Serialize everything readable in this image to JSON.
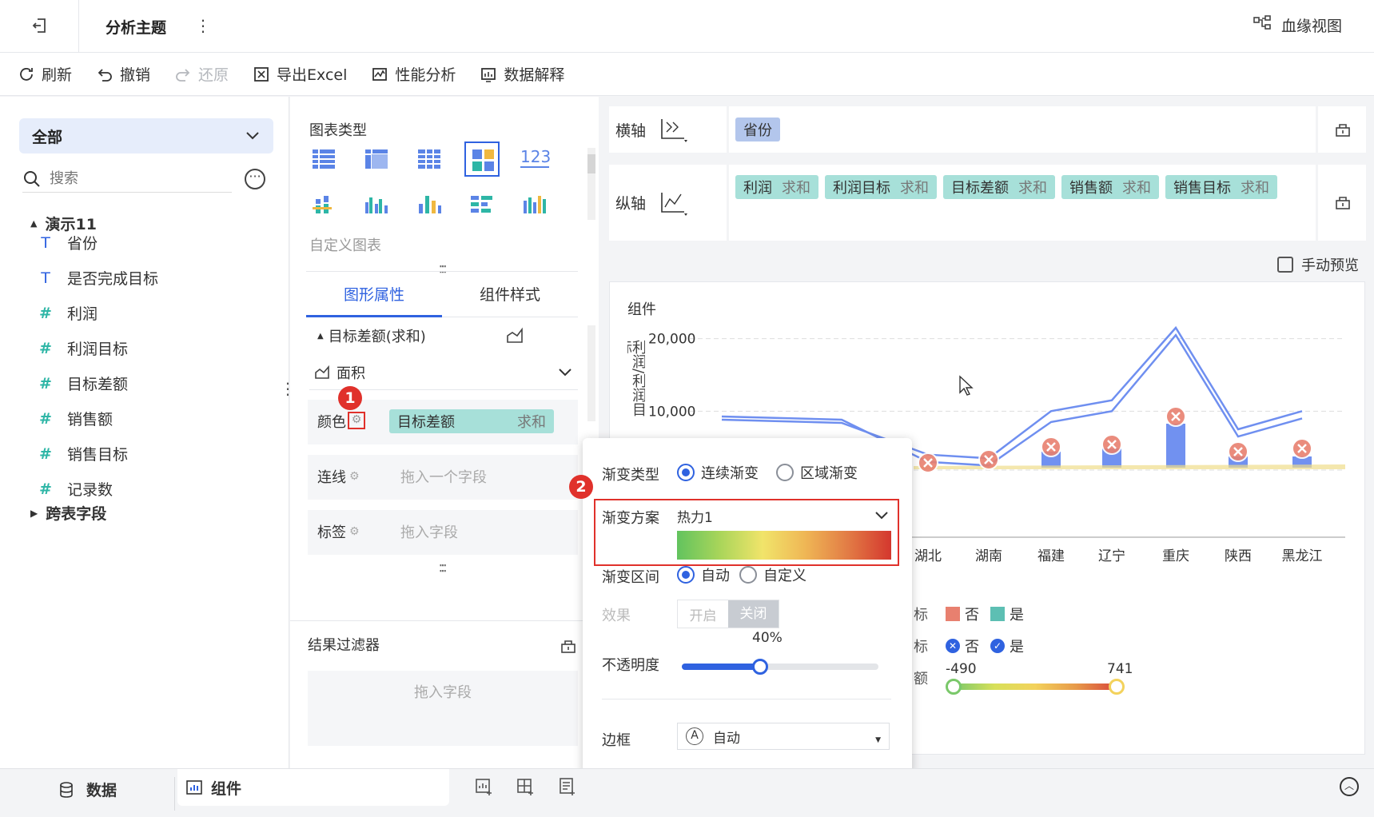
{
  "topbar": {
    "back_icon": "exit-icon",
    "title": "分析主题",
    "more_icon": "vertical-dots-icon",
    "lineage_label": "血缘视图",
    "lineage_icon": "lineage-icon"
  },
  "toolbar": {
    "refresh": "刷新",
    "undo": "撤销",
    "redo": "还原",
    "export": "导出Excel",
    "perf": "性能分析",
    "explain": "数据解释"
  },
  "left": {
    "scope": "全部",
    "search_placeholder": "搜索",
    "dataset": "演示11",
    "fields": [
      {
        "type": "text",
        "icon": "T",
        "label": "省份"
      },
      {
        "type": "text",
        "icon": "T",
        "label": "是否完成目标"
      },
      {
        "type": "number",
        "icon": "#",
        "label": "利润"
      },
      {
        "type": "number",
        "icon": "#",
        "label": "利润目标"
      },
      {
        "type": "number",
        "icon": "#",
        "label": "目标差额"
      },
      {
        "type": "number",
        "icon": "#",
        "label": "销售额"
      },
      {
        "type": "number",
        "icon": "#",
        "label": "销售目标"
      },
      {
        "type": "count",
        "icon": "#",
        "label": "记录数"
      }
    ],
    "cross_table": "跨表字段"
  },
  "mid": {
    "chart_type_title": "图表类型",
    "custom_chart": "自定义图表",
    "number_icon_text": "123",
    "tabs": [
      "图形属性",
      "组件样式"
    ],
    "measure_title": "目标差额(求和)",
    "shape_label": "面积",
    "color_label": "颜色",
    "color_pill_name": "目标差额",
    "color_pill_agg": "求和",
    "line_label": "连线",
    "line_placeholder": "拖入一个字段",
    "label_label": "标签",
    "label_placeholder": "拖入字段",
    "filter_title": "结果过滤器",
    "filter_placeholder": "拖入字段",
    "badge1": "1"
  },
  "axes": {
    "x_label": "横轴",
    "x_pill": "省份",
    "y_label": "纵轴",
    "y_pills": [
      {
        "name": "利润",
        "agg": "求和"
      },
      {
        "name": "利润目标",
        "agg": "求和"
      },
      {
        "name": "目标差额",
        "agg": "求和"
      },
      {
        "name": "销售额",
        "agg": "求和"
      },
      {
        "name": "销售目标",
        "agg": "求和"
      }
    ],
    "manual_preview": "手动预览"
  },
  "chart": {
    "title": "组件",
    "ylabel": "利润/利润目标",
    "legend_labels": [
      "标",
      "标",
      "额"
    ],
    "legend_no": "否",
    "legend_yes": "是",
    "range_min": "-490",
    "range_max": "741",
    "colors": {
      "line": "#6f8ff0",
      "bar": "#7191f0",
      "no": "#e8806f",
      "yes": "#5dbfb3"
    }
  },
  "chart_data": {
    "type": "line",
    "title": "组件",
    "ylabel": "利润/利润目标",
    "y_ticks": [
      "20,000",
      "10,000"
    ],
    "categories": [
      "湖北",
      "湖南",
      "福建",
      "辽宁",
      "重庆",
      "陕西",
      "黑龙江"
    ],
    "ylim": [
      0,
      25000
    ],
    "series": [
      {
        "name": "利润",
        "values": [
          3000,
          2500,
          8500,
          10000,
          20500,
          6500,
          9000
        ]
      },
      {
        "name": "利润目标",
        "values": [
          4000,
          3500,
          10000,
          11500,
          21500,
          7500,
          10000
        ]
      }
    ],
    "legend": [
      "否",
      "是"
    ],
    "color_range": [
      -490,
      741
    ]
  },
  "popup": {
    "gradient_type_label": "渐变类型",
    "gradient_options": [
      "连续渐变",
      "区域渐变"
    ],
    "scheme_label": "渐变方案",
    "scheme_value": "热力1",
    "range_label": "渐变区间",
    "range_options": [
      "自动",
      "自定义"
    ],
    "effect_label": "效果",
    "effect_on": "开启",
    "effect_off": "关闭",
    "opacity_value": "40%",
    "opacity_fraction": 0.4,
    "opacity_label": "不透明度",
    "border_label": "边框",
    "border_value": "自动",
    "badge2": "2"
  },
  "bottom": {
    "data_tab": "数据",
    "component_tab": "组件"
  }
}
